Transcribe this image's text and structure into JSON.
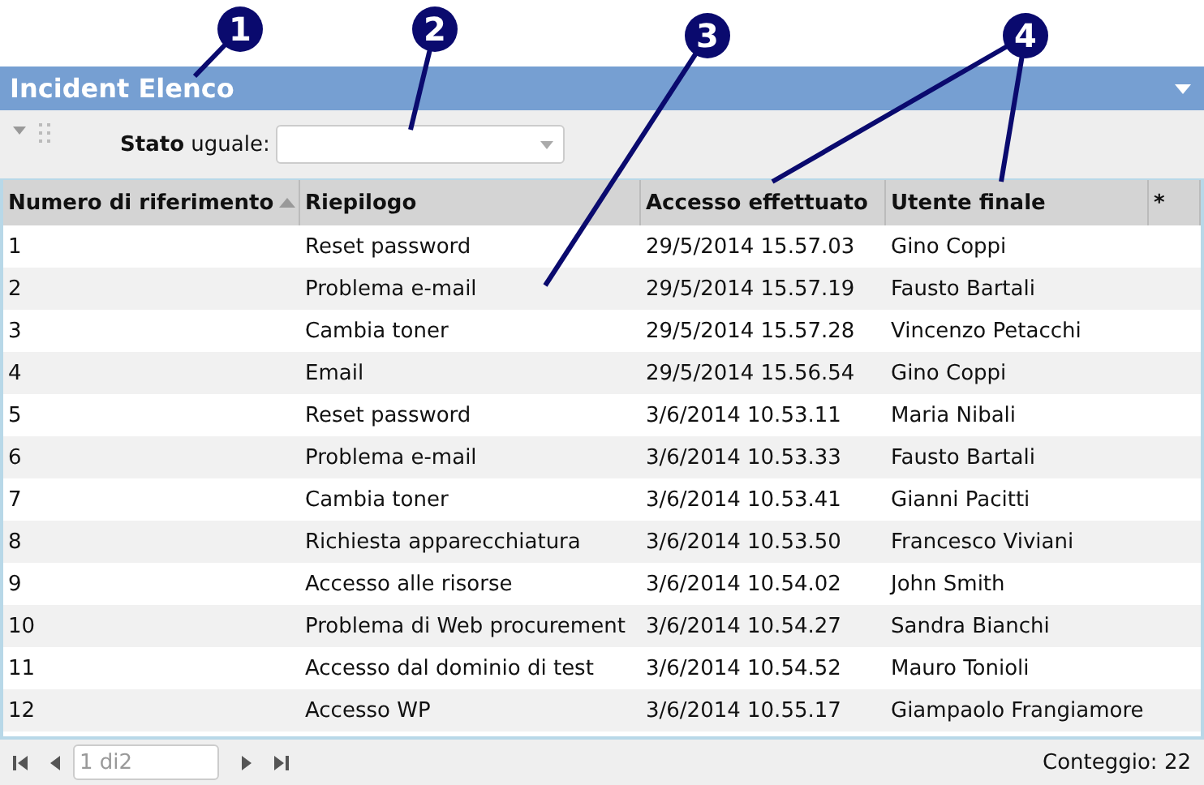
{
  "callouts": [
    {
      "label": "1"
    },
    {
      "label": "2"
    },
    {
      "label": "3"
    },
    {
      "label": "4"
    }
  ],
  "panel": {
    "title": "Incident Elenco"
  },
  "filter": {
    "label_bold": "Stato",
    "label": "uguale:"
  },
  "table": {
    "columns": [
      {
        "label": "Numero di riferimento",
        "sorted": true
      },
      {
        "label": "Riepilogo",
        "sorted": false
      },
      {
        "label": "Accesso effettuato",
        "sorted": false
      },
      {
        "label": "Utente finale",
        "sorted": false
      },
      {
        "label": "*",
        "sorted": false
      }
    ],
    "rows": [
      [
        "1",
        "Reset password",
        "29/5/2014 15.57.03",
        "Gino Coppi"
      ],
      [
        "2",
        "Problema e-mail",
        "29/5/2014 15.57.19",
        "Fausto Bartali"
      ],
      [
        "3",
        "Cambia toner",
        "29/5/2014 15.57.28",
        "Vincenzo Petacchi"
      ],
      [
        "4",
        "Email",
        "29/5/2014 15.56.54",
        "Gino Coppi"
      ],
      [
        "5",
        "Reset password",
        "3/6/2014 10.53.11",
        "Maria Nibali"
      ],
      [
        "6",
        "Problema e-mail",
        "3/6/2014 10.53.33",
        "Fausto Bartali"
      ],
      [
        "7",
        "Cambia toner",
        "3/6/2014 10.53.41",
        "Gianni Pacitti"
      ],
      [
        "8",
        "Richiesta apparecchiatura",
        "3/6/2014 10.53.50",
        "Francesco Viviani"
      ],
      [
        "9",
        "Accesso alle risorse",
        "3/6/2014 10.54.02",
        "John Smith"
      ],
      [
        "10",
        "Problema di Web procurement",
        "3/6/2014 10.54.27",
        "Sandra Bianchi"
      ],
      [
        "11",
        "Accesso dal dominio di test",
        "3/6/2014 10.54.52",
        "Mauro Tonioli"
      ],
      [
        "12",
        "Accesso WP",
        "3/6/2014 10.55.17",
        "Giampaolo Frangiamore"
      ]
    ]
  },
  "pager": {
    "page": "1 di2",
    "count": "Conteggio: 22"
  }
}
